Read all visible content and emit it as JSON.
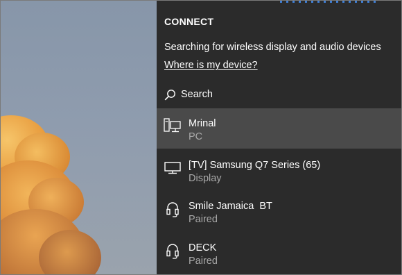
{
  "panel": {
    "title": "CONNECT",
    "status": "Searching for wireless display and audio devices",
    "help_link": "Where is my device?",
    "search_label": "Search",
    "search_icon": "search-icon"
  },
  "devices": [
    {
      "name": "Mrinal",
      "sub": "PC",
      "icon": "pc-icon",
      "selected": true
    },
    {
      "name": "[TV] Samsung Q7 Series (65)",
      "sub": "Display",
      "icon": "display-icon",
      "selected": false
    },
    {
      "name": "Smile Jamaica  BT",
      "sub": "Paired",
      "icon": "headset-icon",
      "selected": false
    },
    {
      "name": "DECK",
      "sub": "Paired",
      "icon": "headset-icon",
      "selected": false
    }
  ],
  "colors": {
    "panel_bg": "#2b2b2b",
    "selected_bg": "#4a4a4a",
    "secondary_text": "#a9a9a9",
    "accent": "#3f7fd6"
  }
}
